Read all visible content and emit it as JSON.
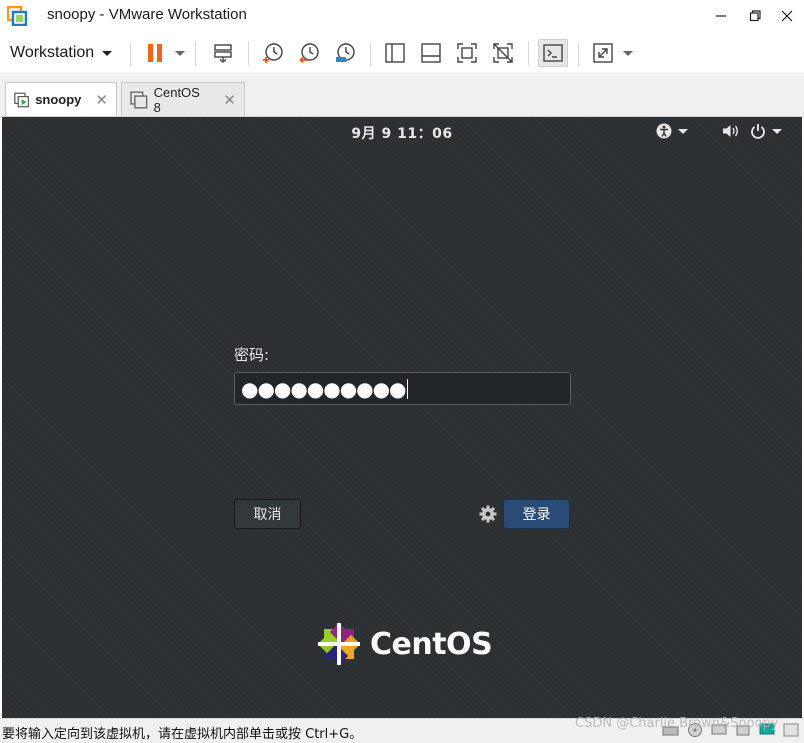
{
  "window": {
    "title": "snoopy - VMware Workstation",
    "minimize_icon": "minimize-icon",
    "maximize_icon": "maximize-icon",
    "close_icon": "close-icon"
  },
  "toolbar": {
    "menu_label": "Workstation",
    "pause_color": "#f0651f",
    "icons": [
      "pause-icon",
      "send-ctrl-alt-del-icon",
      "snapshot-take-icon",
      "snapshot-revert-icon",
      "snapshot-manager-icon",
      "view-library-icon",
      "view-thumbnail-icon",
      "fullscreen-icon",
      "unity-icon",
      "console-icon",
      "stretch-icon"
    ]
  },
  "tabs": [
    {
      "label": "snoopy",
      "active": true
    },
    {
      "label": "CentOS 8",
      "active": false
    }
  ],
  "vm": {
    "clock": "9月 9  11：06",
    "password_label": "密码:",
    "password_value": "●●●●●●●●●●",
    "cancel_label": "取消",
    "login_label": "登录",
    "brand": "CentOS",
    "accent_color": "#2a4b75"
  },
  "statusbar": {
    "hint": "要将输入定向到该虚拟机，请在虚拟机内部单击或按 Ctrl+G。",
    "watermark": "CSDN @Charlie Brown&Snoopy"
  }
}
